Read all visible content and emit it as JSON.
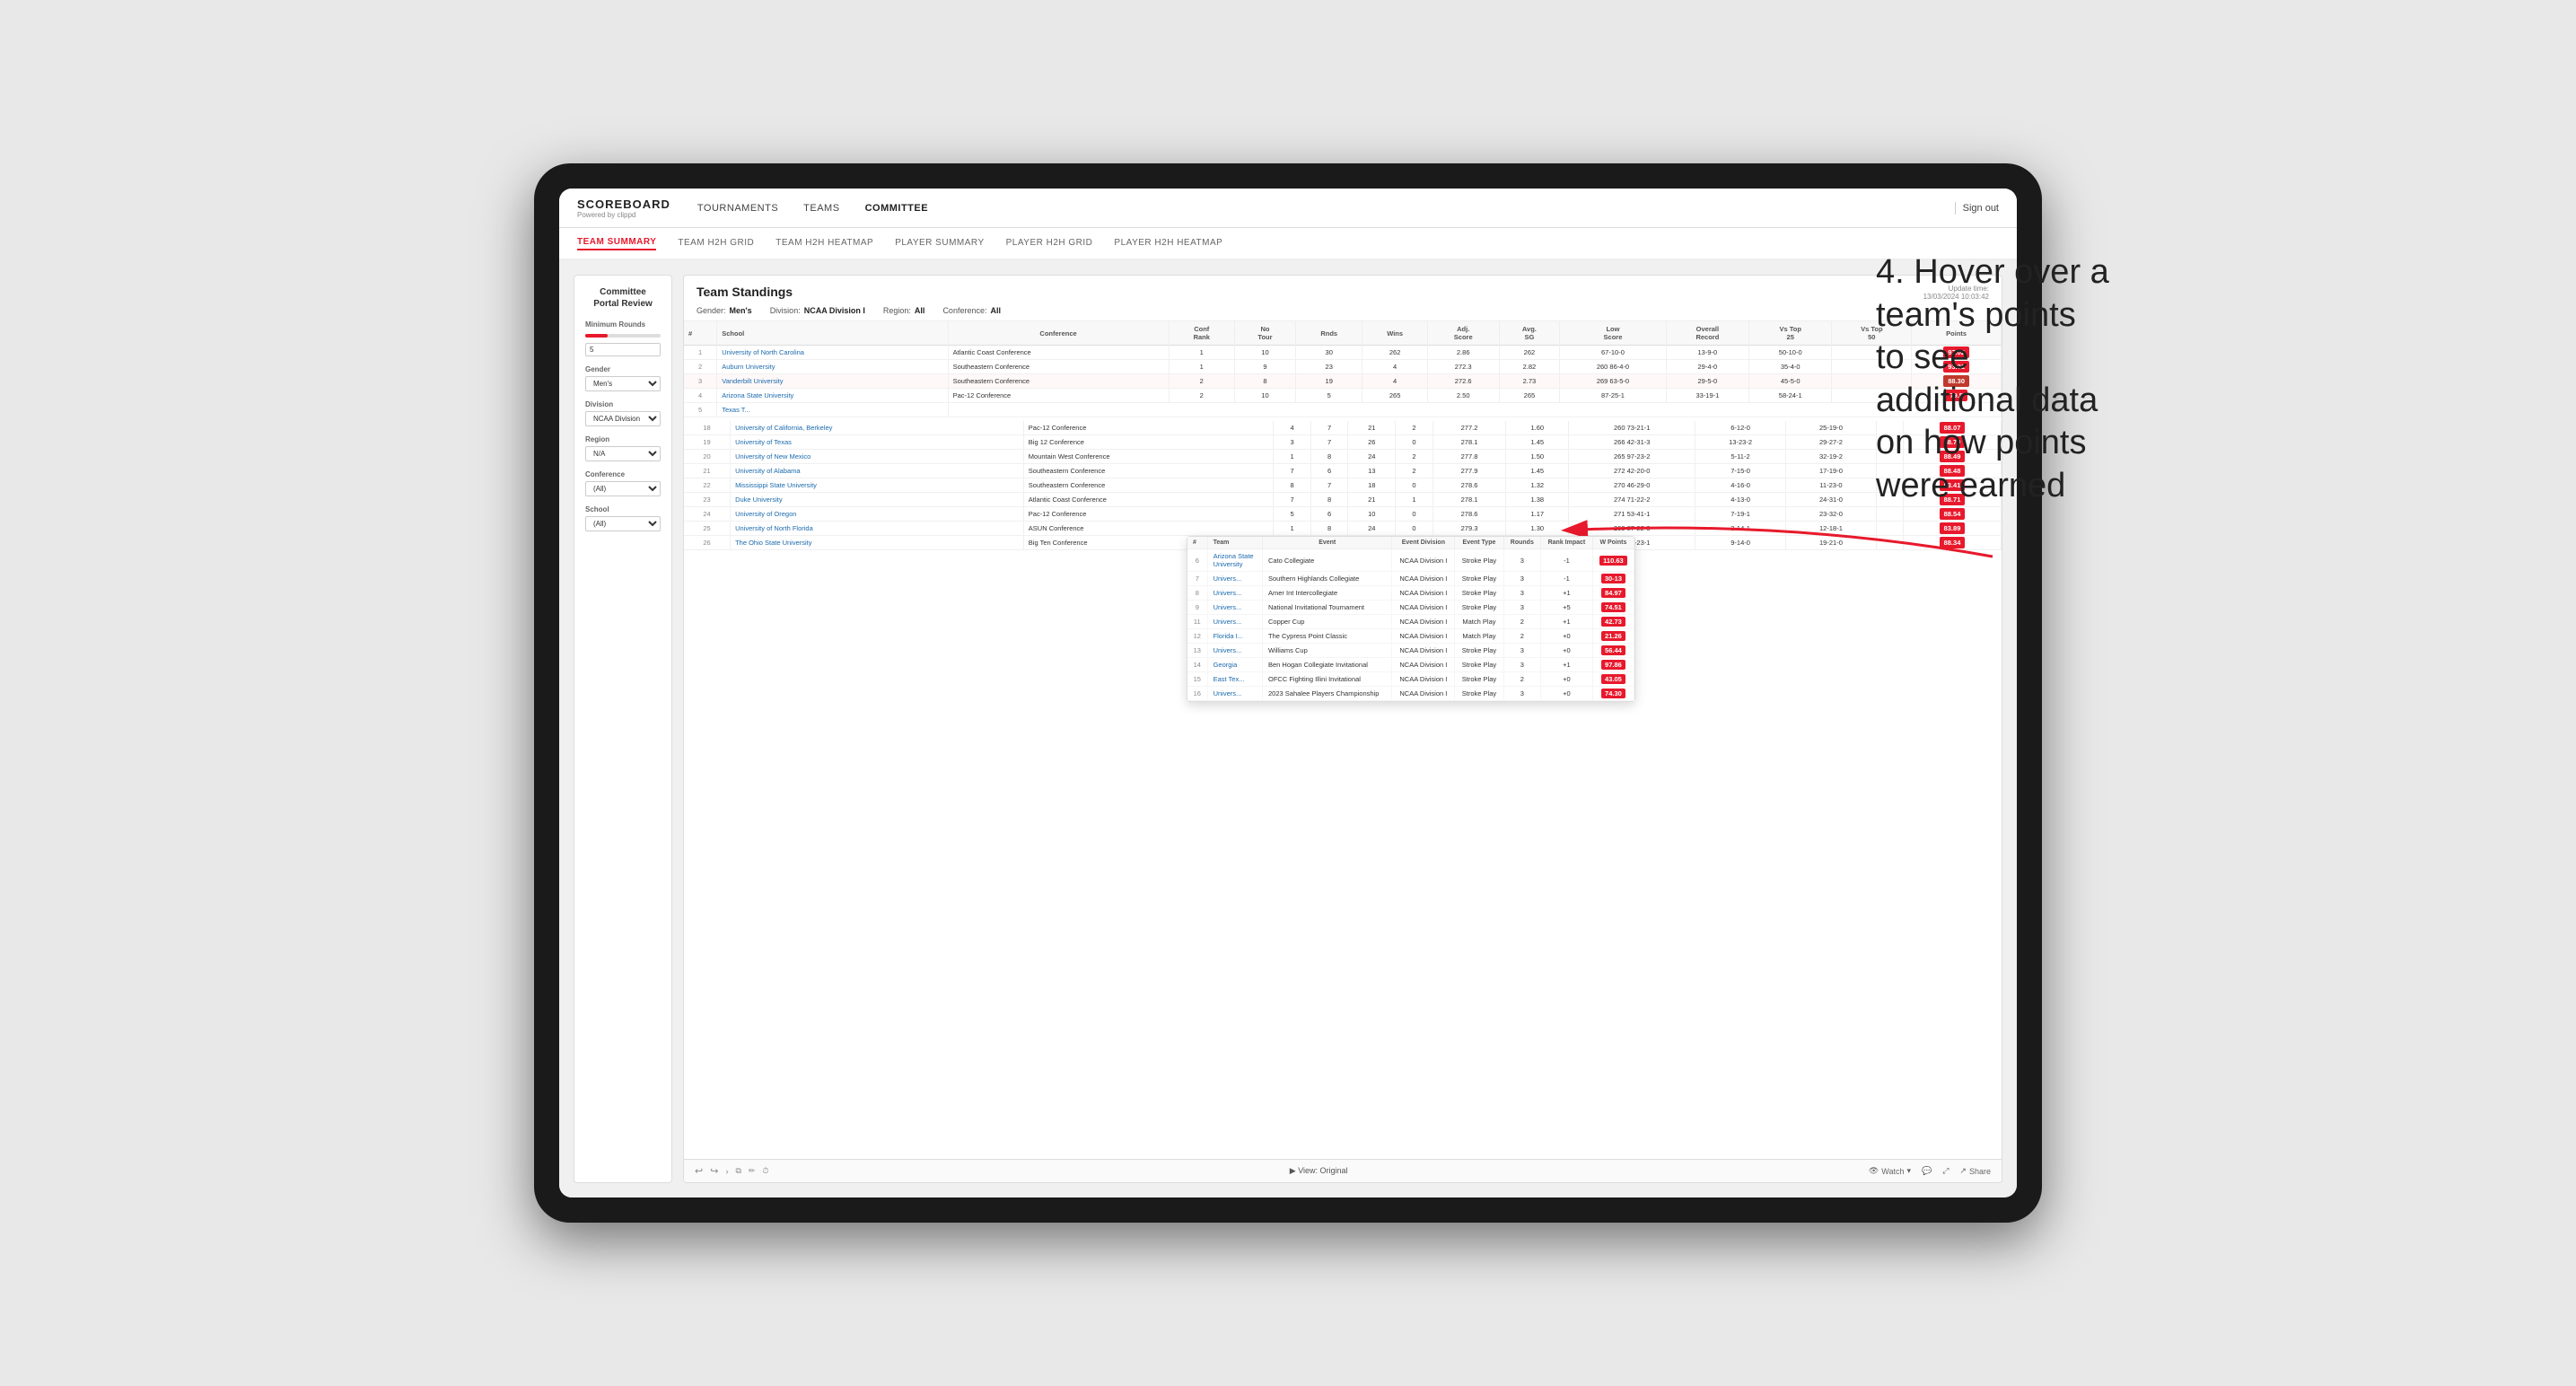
{
  "app": {
    "logo": "SCOREBOARD",
    "logo_sub": "Powered by clippd",
    "sign_out": "Sign out"
  },
  "nav": {
    "items": [
      "TOURNAMENTS",
      "TEAMS",
      "COMMITTEE"
    ],
    "active": "COMMITTEE"
  },
  "sub_nav": {
    "items": [
      "TEAM SUMMARY",
      "TEAM H2H GRID",
      "TEAM H2H HEATMAP",
      "PLAYER SUMMARY",
      "PLAYER H2H GRID",
      "PLAYER H2H HEATMAP"
    ],
    "active": "TEAM SUMMARY"
  },
  "sidebar": {
    "title": "Committee\nPortal Review",
    "filters": [
      {
        "label": "Minimum Rounds",
        "type": "range",
        "value": "5"
      },
      {
        "label": "Gender",
        "type": "select",
        "value": "Men's"
      },
      {
        "label": "Division",
        "type": "select",
        "value": "NCAA Division I"
      },
      {
        "label": "Region",
        "type": "select",
        "value": "N/A"
      },
      {
        "label": "Conference",
        "type": "select",
        "value": "(All)"
      },
      {
        "label": "School",
        "type": "select",
        "value": "(All)"
      }
    ]
  },
  "panel": {
    "title": "Team Standings",
    "update_time": "Update time:",
    "update_datetime": "13/03/2024 10:03:42",
    "filters": {
      "gender_label": "Gender:",
      "gender_value": "Men's",
      "division_label": "Division:",
      "division_value": "NCAA Division I",
      "region_label": "Region:",
      "region_value": "All",
      "conference_label": "Conference:",
      "conference_value": "All"
    },
    "table_headers": [
      "#",
      "School",
      "Conference",
      "Conf Rank",
      "No Tour",
      "Rnds",
      "Wins",
      "Adj. Score",
      "Avg. SG",
      "Low Score",
      "Overall Record",
      "Vs Top 25",
      "Vs Top 50",
      "Points"
    ],
    "rows": [
      {
        "rank": "1",
        "school": "University of North Carolina",
        "conference": "Atlantic Coast Conference",
        "conf_rank": "1",
        "no_tour": "10",
        "rnds": "30",
        "wins": "262",
        "adj_score": "2.86",
        "avg_sg": "262",
        "low_score": "67-10-0",
        "overall": "13-9-0",
        "vs25": "50-10-0",
        "vs50": "",
        "points": "97.02",
        "highlight": false
      },
      {
        "rank": "2",
        "school": "Auburn University",
        "conference": "Southeastern Conference",
        "conf_rank": "1",
        "no_tour": "9",
        "rnds": "23",
        "wins": "4",
        "adj_score": "272.3",
        "avg_sg": "2.82",
        "low_score": "260 86-4-0",
        "overall": "29-4-0",
        "vs25": "35-4-0",
        "vs50": "",
        "points": "93.31",
        "highlight": false
      },
      {
        "rank": "3",
        "school": "Vanderbilt University",
        "conference": "Southeastern Conference",
        "conf_rank": "2",
        "no_tour": "8",
        "rnds": "19",
        "wins": "4",
        "adj_score": "272.6",
        "avg_sg": "2.73",
        "low_score": "269 63-5-0",
        "overall": "29-5-0",
        "vs25": "45-5-0",
        "vs50": "",
        "points": "88.30",
        "highlight": true
      },
      {
        "rank": "4",
        "school": "Arizona State University",
        "conference": "Pac-12 Conference",
        "conf_rank": "2",
        "no_tour": "10",
        "rnds": "5",
        "wins": "265",
        "adj_score": "2.50",
        "avg_sg": "265",
        "low_score": "87-25-1",
        "overall": "33-19-1",
        "vs25": "58-24-1",
        "vs50": "",
        "points": "79.5",
        "highlight": false
      },
      {
        "rank": "5",
        "school": "Texas T...",
        "conference": "",
        "conf_rank": "",
        "no_tour": "",
        "rnds": "",
        "wins": "",
        "adj_score": "",
        "avg_sg": "",
        "low_score": "",
        "overall": "",
        "vs25": "",
        "vs50": "",
        "points": "",
        "highlight": false
      },
      {
        "rank": "18",
        "school": "University of California, Berkeley",
        "conference": "Pac-12 Conference",
        "conf_rank": "4",
        "no_tour": "7",
        "rnds": "21",
        "wins": "2",
        "adj_score": "277.2",
        "avg_sg": "1.60",
        "low_score": "260 73-21-1",
        "overall": "6-12-0",
        "vs25": "25-19-0",
        "vs50": "",
        "points": "88.07",
        "highlight": false
      },
      {
        "rank": "19",
        "school": "University of Texas",
        "conference": "Big 12 Conference",
        "conf_rank": "3",
        "no_tour": "7",
        "rnds": "26",
        "wins": "0",
        "adj_score": "278.1",
        "avg_sg": "1.45",
        "low_score": "266 42-31-3",
        "overall": "13-23-2",
        "vs25": "29-27-2",
        "vs50": "",
        "points": "88.70",
        "highlight": false
      },
      {
        "rank": "20",
        "school": "University of New Mexico",
        "conference": "Mountain West Conference",
        "conf_rank": "1",
        "no_tour": "8",
        "rnds": "24",
        "wins": "2",
        "adj_score": "277.8",
        "avg_sg": "1.50",
        "low_score": "265 97-23-2",
        "overall": "5-11-2",
        "vs25": "32-19-2",
        "vs50": "",
        "points": "88.49",
        "highlight": false
      },
      {
        "rank": "21",
        "school": "University of Alabama",
        "conference": "Southeastern Conference",
        "conf_rank": "7",
        "no_tour": "6",
        "rnds": "13",
        "wins": "2",
        "adj_score": "277.9",
        "avg_sg": "1.45",
        "low_score": "272 42-20-0",
        "overall": "7-15-0",
        "vs25": "17-19-0",
        "vs50": "",
        "points": "88.48",
        "highlight": false
      },
      {
        "rank": "22",
        "school": "Mississippi State University",
        "conference": "Southeastern Conference",
        "conf_rank": "8",
        "no_tour": "7",
        "rnds": "18",
        "wins": "0",
        "adj_score": "278.6",
        "avg_sg": "1.32",
        "low_score": "270 46-29-0",
        "overall": "4-16-0",
        "vs25": "11-23-0",
        "vs50": "",
        "points": "83.41",
        "highlight": false
      },
      {
        "rank": "23",
        "school": "Duke University",
        "conference": "Atlantic Coast Conference",
        "conf_rank": "7",
        "no_tour": "8",
        "rnds": "21",
        "wins": "1",
        "adj_score": "278.1",
        "avg_sg": "1.38",
        "low_score": "274 71-22-2",
        "overall": "4-13-0",
        "vs25": "24-31-0",
        "vs50": "",
        "points": "88.71",
        "highlight": false
      },
      {
        "rank": "24",
        "school": "University of Oregon",
        "conference": "Pac-12 Conference",
        "conf_rank": "5",
        "no_tour": "6",
        "rnds": "10",
        "wins": "0",
        "adj_score": "278.6",
        "avg_sg": "1.17",
        "low_score": "271 53-41-1",
        "overall": "7-19-1",
        "vs25": "23-32-0",
        "vs50": "",
        "points": "88.54",
        "highlight": false
      },
      {
        "rank": "25",
        "school": "University of North Florida",
        "conference": "ASUN Conference",
        "conf_rank": "1",
        "no_tour": "8",
        "rnds": "24",
        "wins": "0",
        "adj_score": "279.3",
        "avg_sg": "1.30",
        "low_score": "269 87-22-3",
        "overall": "3-14-1",
        "vs25": "12-18-1",
        "vs50": "",
        "points": "83.89",
        "highlight": false
      },
      {
        "rank": "26",
        "school": "The Ohio State University",
        "conference": "Big Ten Conference",
        "conf_rank": "2",
        "no_tour": "8",
        "rnds": "18",
        "wins": "0",
        "adj_score": "280.7",
        "avg_sg": "1.22",
        "low_score": "267 55-23-1",
        "overall": "9-14-0",
        "vs25": "19-21-0",
        "vs50": "",
        "points": "88.34",
        "highlight": false
      }
    ],
    "popup_rows": [
      {
        "team": "Arizona State\nUniversity",
        "event": "Cato Collegiate",
        "event_division": "NCAA Division I",
        "event_type": "Stroke Play",
        "rounds": "3",
        "rank_impact": "-1",
        "w_points": "110.63"
      },
      {
        "team": "Univers...",
        "event": "Southern Highlands Collegiate",
        "event_division": "NCAA Division I",
        "event_type": "Stroke Play",
        "rounds": "3",
        "rank_impact": "-1",
        "w_points": "30-13"
      },
      {
        "team": "Univers...",
        "event": "Amer Int Intercollegiate",
        "event_division": "NCAA Division I",
        "event_type": "Stroke Play",
        "rounds": "3",
        "rank_impact": "+1",
        "w_points": "84.97"
      },
      {
        "team": "Univers...",
        "event": "National Invitational Tournament",
        "event_division": "NCAA Division I",
        "event_type": "Stroke Play",
        "rounds": "3",
        "rank_impact": "+5",
        "w_points": "74.51"
      },
      {
        "team": "Univers...",
        "event": "Copper Cup",
        "event_division": "NCAA Division I",
        "event_type": "Match Play",
        "rounds": "2",
        "rank_impact": "+1",
        "w_points": "42.73"
      },
      {
        "team": "Florida I...",
        "event": "The Cypress Point Classic",
        "event_division": "NCAA Division I",
        "event_type": "Match Play",
        "rounds": "2",
        "rank_impact": "+0",
        "w_points": "21.26"
      },
      {
        "team": "Univers...",
        "event": "Williams Cup",
        "event_division": "NCAA Division I",
        "event_type": "Stroke Play",
        "rounds": "3",
        "rank_impact": "+0",
        "w_points": "56.44"
      },
      {
        "team": "Georgia",
        "event": "Ben Hogan Collegiate Invitational",
        "event_division": "NCAA Division I",
        "event_type": "Stroke Play",
        "rounds": "3",
        "rank_impact": "+1",
        "w_points": "97.86"
      },
      {
        "team": "East Tex...",
        "event": "OFCC Fighting Illini Invitational",
        "event_division": "NCAA Division I",
        "event_type": "Stroke Play",
        "rounds": "2",
        "rank_impact": "+0",
        "w_points": "43.05"
      },
      {
        "team": "Univers...",
        "event": "2023 Sahalee Players Championship",
        "event_division": "NCAA Division I",
        "event_type": "Stroke Play",
        "rounds": "3",
        "rank_impact": "+0",
        "w_points": "74.30"
      }
    ],
    "popup_headers": [
      "#",
      "Team",
      "Event",
      "Event Division",
      "Event Type",
      "Rounds",
      "Rank Impact",
      "W Points"
    ]
  },
  "toolbar": {
    "undo": "↩",
    "redo": "↪",
    "view_label": "View: Original",
    "watch_label": "Watch",
    "share_label": "Share"
  },
  "annotation": {
    "text": "4. Hover over a\nteam's points\nto see\nadditional data\non how points\nwere earned"
  }
}
